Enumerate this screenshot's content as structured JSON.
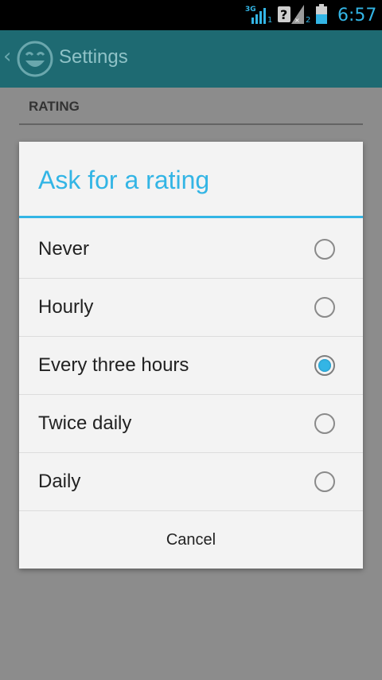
{
  "status_bar": {
    "network_label": "3G",
    "sim1": "1",
    "sim2": "2",
    "clock": "6:57",
    "accent_color": "#33b5e5"
  },
  "action_bar": {
    "title": "Settings",
    "back_icon": "chevron-left-icon",
    "logo_icon": "smiley-face-icon"
  },
  "screen": {
    "section_header": "RATING"
  },
  "dialog": {
    "title": "Ask for a rating",
    "options": [
      {
        "label": "Never",
        "checked": false
      },
      {
        "label": "Hourly",
        "checked": false
      },
      {
        "label": "Every three hours",
        "checked": true
      },
      {
        "label": "Twice daily",
        "checked": false
      },
      {
        "label": "Daily",
        "checked": false
      }
    ],
    "cancel_label": "Cancel",
    "accent_color": "#33b5e5"
  }
}
